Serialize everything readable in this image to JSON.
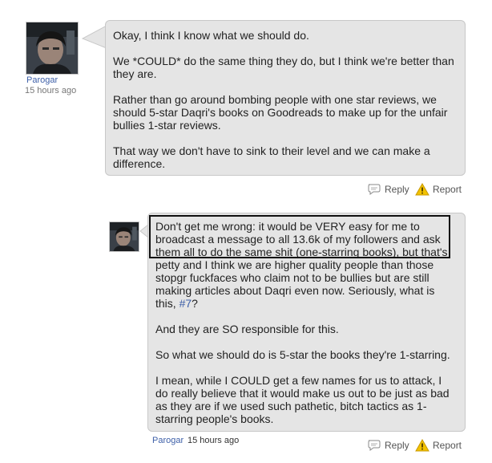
{
  "comment_1": {
    "avatar_icon": "user-avatar-photo",
    "author": "Parogar",
    "time": "15 hours ago",
    "paragraphs": [
      "Okay, I think I know what we should do.",
      "We *COULD* do the same thing they do, but I think we're better than they are.",
      "Rather than go around bombing people with one star reviews, we should 5-star Daqri's books on Goodreads to make up for the unfair bullies 1-star reviews.",
      "That way we don't have to sink to their level and we can make a difference."
    ],
    "reply_label": "Reply",
    "report_label": "Report",
    "reply_icon": "speech-bubble-icon",
    "report_icon": "warning-triangle-icon"
  },
  "comment_2": {
    "avatar_icon": "user-avatar-photo",
    "author": "Parogar",
    "time": "15 hours ago",
    "paragraph_1_text": "Don't get me wrong: it would be VERY easy for me to broadcast a message to all 13.6k of my followers and ask them all to do the same shit (one-starring books), but that's petty and I think we are higher quality people than those stopgr fuckfaces who claim not to be bullies but are still making articles about Daqri even now. Seriously, what is this, ",
    "paragraph_1_link": "#7",
    "paragraph_1_end": "?",
    "paragraphs": [
      "And they are SO responsible for this.",
      "So what we should do is 5-star the books they're 1-starring.",
      "I mean, while I COULD get a few names for us to attack, I do really believe that it would make us out to be just as bad as they are if we used such pathetic, bitch tactics as 1-starring people's books."
    ],
    "reply_label": "Reply",
    "report_label": "Report",
    "reply_icon": "speech-bubble-icon",
    "report_icon": "warning-triangle-icon"
  },
  "colors": {
    "bubble_bg": "#e5e5e5",
    "bubble_border": "#c8c8c8",
    "link": "#3d5fa8",
    "warning": "#f2c200"
  }
}
